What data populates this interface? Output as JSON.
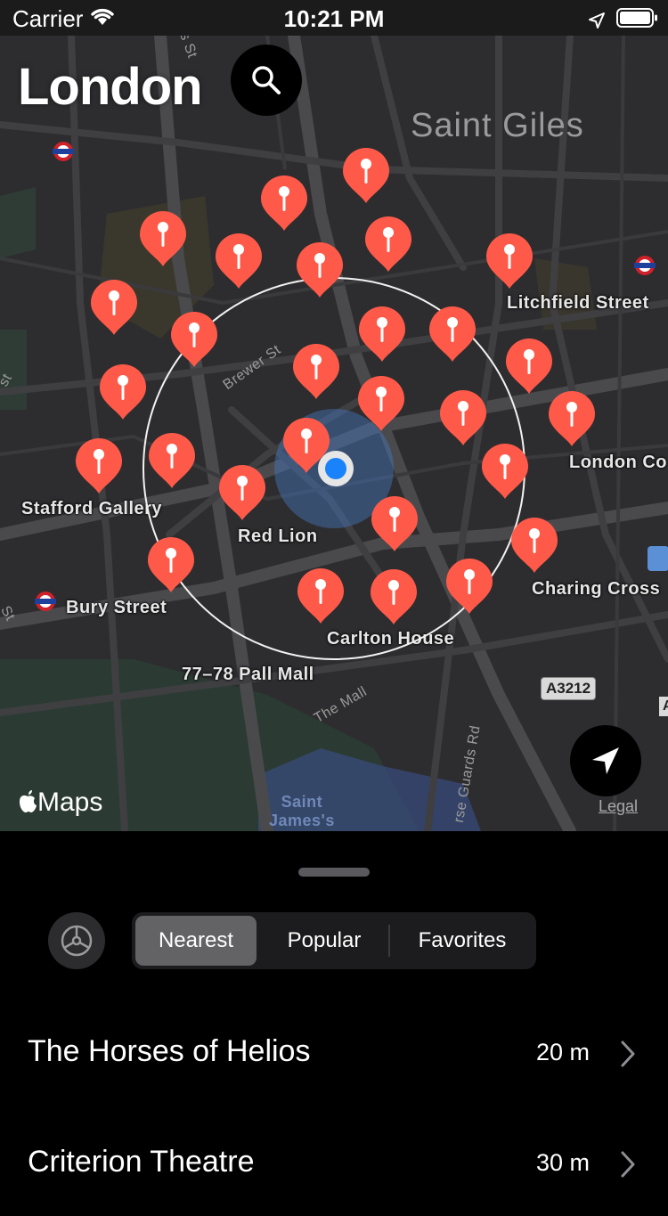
{
  "status_bar": {
    "carrier": "Carrier",
    "time": "10:21 PM",
    "icons": [
      "wifi-icon",
      "location-arrow-icon",
      "battery-icon"
    ]
  },
  "header": {
    "city": "London",
    "search_icon": "magnifying-glass-icon"
  },
  "map": {
    "labels": {
      "saint_giles": "Saint Giles",
      "litchfield_street": "Litchfield Street",
      "london_co": "London Co",
      "stafford_gallery": "Stafford Gallery",
      "red_lion": "Red Lion",
      "charing_cross": "Charing Cross",
      "bury_street": "Bury Street",
      "carlton_house": "Carlton House",
      "pall_mall": "77–78 Pall Mall",
      "brewer_st": "Brewer St",
      "the_mall": "The Mall",
      "horse_guards_rd": "rse Guards Rd",
      "saint_james": "Saint\nJames's",
      "frag_s_st": "s St",
      "frag_st_left": "st",
      "frag_st_left2": "St",
      "frag_a": "A"
    },
    "road_shield": "A3212",
    "attribution": "Maps",
    "legal": "Legal",
    "pin_count": 28,
    "colors": {
      "pin": "#ff5a49",
      "user_location": "#1a82fb",
      "background": "#2c2c2e"
    },
    "location_button_icon": "location-arrow-icon"
  },
  "sheet": {
    "settings_icon": "steering-wheel-icon",
    "segments": [
      {
        "label": "Nearest",
        "selected": true
      },
      {
        "label": "Popular",
        "selected": false
      },
      {
        "label": "Favorites",
        "selected": false
      }
    ],
    "list": [
      {
        "name": "The Horses of Helios",
        "distance": "20 m"
      },
      {
        "name": "Criterion Theatre",
        "distance": "30 m"
      }
    ]
  }
}
